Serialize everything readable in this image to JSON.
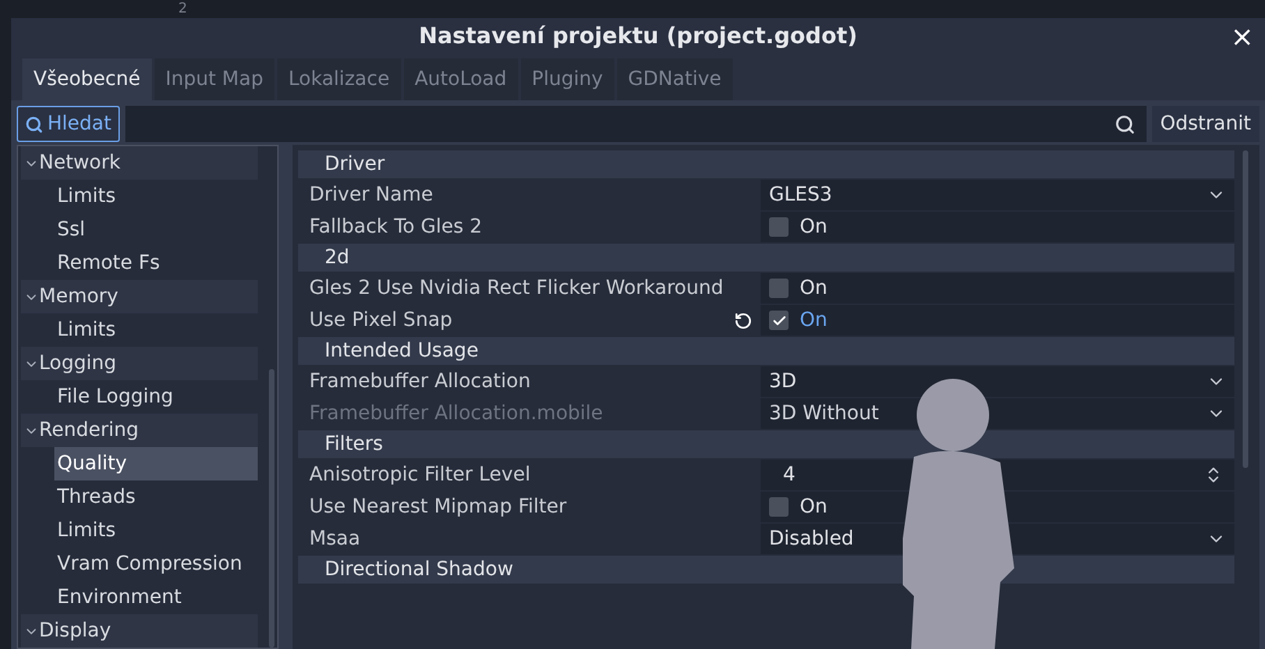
{
  "background_editor": {
    "line_number": "2"
  },
  "window": {
    "title": "Nastavení projektu (project.godot)",
    "close": "×"
  },
  "tabs": [
    {
      "label": "Všeobecné",
      "selected": true
    },
    {
      "label": "Input Map",
      "selected": false
    },
    {
      "label": "Lokalizace",
      "selected": false
    },
    {
      "label": "AutoLoad",
      "selected": false
    },
    {
      "label": "Pluginy",
      "selected": false
    },
    {
      "label": "GDNative",
      "selected": false
    }
  ],
  "toolbar": {
    "search_toggle": {
      "label": "Hledat",
      "pressed": true
    },
    "search_field": {
      "icon": true
    },
    "delete_button": "Odstranit"
  },
  "sidebar": {
    "items": [
      {
        "label": "Network",
        "expanded": true,
        "selected": false,
        "children": [
          {
            "label": "Limits",
            "selected": false
          },
          {
            "label": "Ssl",
            "selected": false
          },
          {
            "label": "Remote Fs",
            "selected": false
          }
        ]
      },
      {
        "label": "Memory",
        "expanded": true,
        "selected": false,
        "children": [
          {
            "label": "Limits",
            "selected": false
          }
        ]
      },
      {
        "label": "Logging",
        "expanded": true,
        "selected": false,
        "children": [
          {
            "label": "File Logging",
            "selected": false
          }
        ]
      },
      {
        "label": "Rendering",
        "expanded": true,
        "selected": false,
        "children": [
          {
            "label": "Quality",
            "selected": true
          },
          {
            "label": "Threads",
            "selected": false
          },
          {
            "label": "Limits",
            "selected": false
          },
          {
            "label": "Vram Compression",
            "selected": false
          },
          {
            "label": "Environment",
            "selected": false
          }
        ]
      },
      {
        "label": "Display",
        "expanded": true,
        "selected": false
      }
    ]
  },
  "properties": [
    {
      "kind": "section",
      "label": "Driver"
    },
    {
      "kind": "dropdown",
      "label": "Driver Name",
      "value": "GLES3",
      "disabled": false,
      "modified": false
    },
    {
      "kind": "checkbox",
      "label": "Fallback To Gles 2",
      "value": "On",
      "checked": false,
      "disabled": false,
      "modified": false
    },
    {
      "kind": "section",
      "label": "2d"
    },
    {
      "kind": "checkbox",
      "label": "Gles 2 Use Nvidia Rect Flicker Workaround",
      "value": "On",
      "checked": false,
      "disabled": false,
      "modified": false
    },
    {
      "kind": "checkbox",
      "label": "Use Pixel Snap",
      "value": "On",
      "checked": true,
      "disabled": false,
      "modified": true
    },
    {
      "kind": "section",
      "label": "Intended Usage"
    },
    {
      "kind": "dropdown",
      "label": "Framebuffer Allocation",
      "value": "3D",
      "disabled": false,
      "modified": false
    },
    {
      "kind": "dropdown",
      "label": "Framebuffer Allocation.mobile",
      "value": "3D Without",
      "disabled": true,
      "modified": false
    },
    {
      "kind": "section",
      "label": "Filters"
    },
    {
      "kind": "spinbox",
      "label": "Anisotropic Filter Level",
      "value": "4",
      "disabled": false,
      "modified": false
    },
    {
      "kind": "checkbox",
      "label": "Use Nearest Mipmap Filter",
      "value": "On",
      "checked": false,
      "disabled": false,
      "modified": false
    },
    {
      "kind": "dropdown",
      "label": "Msaa",
      "value": "Disabled",
      "disabled": false,
      "modified": false
    },
    {
      "kind": "section",
      "label": "Directional Shadow"
    }
  ]
}
